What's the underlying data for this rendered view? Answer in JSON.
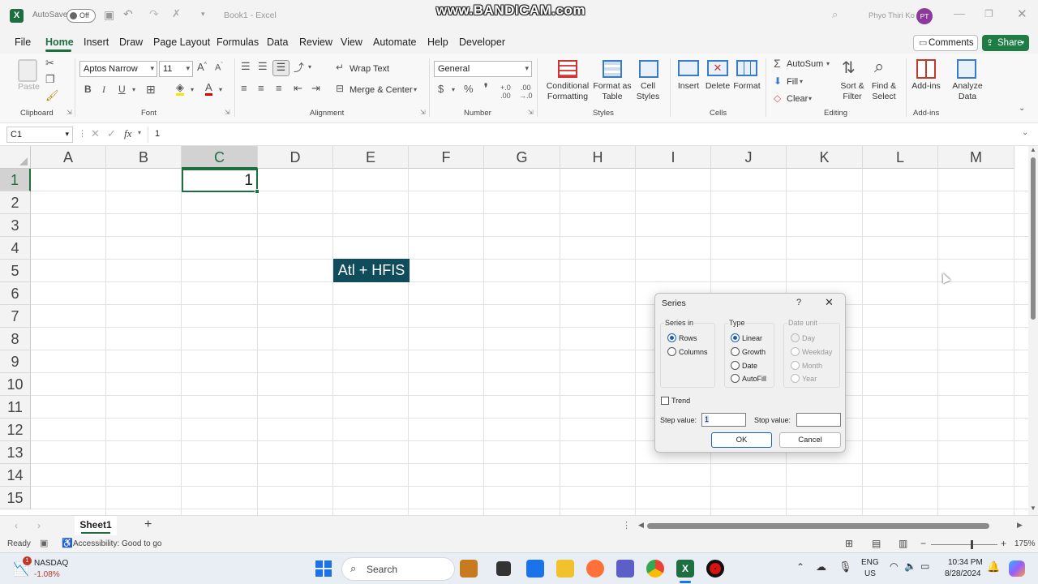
{
  "titlebar": {
    "autosave_label": "AutoSave",
    "autosave_state": "Off",
    "doc_title": "Book1 - Excel",
    "watermark": "www.BANDICAM.com",
    "user_name": "Phyo Thiri Ko",
    "user_initials": "PT"
  },
  "menu": {
    "tabs": [
      "File",
      "Home",
      "Insert",
      "Draw",
      "Page Layout",
      "Formulas",
      "Data",
      "Review",
      "View",
      "Automate",
      "Help",
      "Developer"
    ],
    "active": "Home",
    "comments_label": "Comments",
    "share_label": "Share"
  },
  "ribbon": {
    "clipboard": {
      "paste": "Paste",
      "label": "Clipboard"
    },
    "font": {
      "name": "Aptos Narrow",
      "size": "11",
      "label": "Font"
    },
    "alignment": {
      "wrap": "Wrap Text",
      "merge": "Merge & Center",
      "label": "Alignment"
    },
    "number": {
      "format": "General",
      "label": "Number"
    },
    "styles": {
      "conditional": "Conditional Formatting",
      "format_table": "Format as Table",
      "cell_styles": "Cell Styles",
      "label": "Styles"
    },
    "cells": {
      "insert": "Insert",
      "delete": "Delete",
      "format": "Format",
      "label": "Cells"
    },
    "editing": {
      "autosum": "AutoSum",
      "fill": "Fill",
      "clear": "Clear",
      "sort": "Sort & Filter",
      "find": "Find & Select",
      "label": "Editing"
    },
    "addins": {
      "addins": "Add-ins",
      "analyze": "Analyze Data",
      "label": "Add-ins"
    }
  },
  "formula_bar": {
    "name_box": "C1",
    "fx": "fx",
    "value": "1"
  },
  "grid": {
    "columns": [
      "A",
      "B",
      "C",
      "D",
      "E",
      "F",
      "G",
      "H",
      "I",
      "J",
      "K",
      "L",
      "M"
    ],
    "rows": [
      "1",
      "2",
      "3",
      "4",
      "5",
      "6",
      "7",
      "8",
      "9",
      "10",
      "11",
      "12",
      "13",
      "14",
      "15"
    ],
    "cell_c1": "1",
    "shortcut_overlay": "Atl + HFIS"
  },
  "dialog": {
    "title": "Series",
    "help": "?",
    "series_in": {
      "title": "Series in",
      "rows": "Rows",
      "columns": "Columns"
    },
    "type": {
      "title": "Type",
      "linear": "Linear",
      "growth": "Growth",
      "date": "Date",
      "autofill": "AutoFill"
    },
    "date_unit": {
      "title": "Date unit",
      "day": "Day",
      "weekday": "Weekday",
      "month": "Month",
      "year": "Year"
    },
    "trend": "Trend",
    "step_label": "Step value:",
    "step_value": "1",
    "stop_label": "Stop value:",
    "stop_value": "",
    "ok": "OK",
    "cancel": "Cancel"
  },
  "sheets": {
    "tabs": [
      "Sheet1"
    ],
    "active": "Sheet1"
  },
  "status": {
    "ready": "Ready",
    "accessibility": "Accessibility: Good to go",
    "zoom": "175%"
  },
  "taskbar": {
    "stock_name": "NASDAQ",
    "stock_change": "-1.08%",
    "stock_badge": "1",
    "search": "Search",
    "lang1": "ENG",
    "lang2": "US",
    "time": "10:34 PM",
    "date": "8/28/2024"
  }
}
